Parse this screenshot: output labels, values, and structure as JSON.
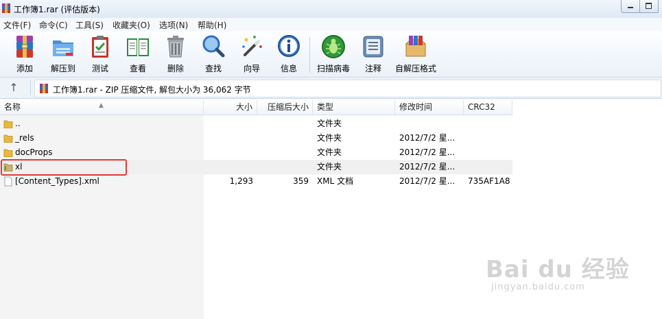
{
  "window": {
    "title": "工作簿1.rar (评估版本)"
  },
  "menu": [
    "文件(F)",
    "命令(C)",
    "工具(S)",
    "收藏夹(O)",
    "选项(N)",
    "帮助(H)"
  ],
  "toolbar": {
    "add": "添加",
    "extract": "解压到",
    "test": "测试",
    "view": "查看",
    "delete": "删除",
    "find": "查找",
    "wizard": "向导",
    "info": "信息",
    "virus_scan": "扫描病毒",
    "comment": "注释",
    "sfx": "自解压格式"
  },
  "address": {
    "text": "工作簿1.rar - ZIP 压缩文件, 解包大小为 36,062 字节"
  },
  "columns": {
    "name": "名称",
    "size": "大小",
    "packed": "压缩后大小",
    "type": "类型",
    "modified": "修改时间",
    "crc": "CRC32"
  },
  "files": [
    {
      "name": "..",
      "size": "",
      "packed": "",
      "type": "文件夹",
      "modified": "",
      "crc": ""
    },
    {
      "name": "_rels",
      "size": "",
      "packed": "",
      "type": "文件夹",
      "modified": "2012/7/2 星...",
      "crc": ""
    },
    {
      "name": "docProps",
      "size": "",
      "packed": "",
      "type": "文件夹",
      "modified": "2012/7/2 星...",
      "crc": ""
    },
    {
      "name": "xl",
      "size": "",
      "packed": "",
      "type": "文件夹",
      "modified": "2012/7/2 星...",
      "crc": ""
    },
    {
      "name": "[Content_Types].xml",
      "size": "1,293",
      "packed": "359",
      "type": "XML 文档",
      "modified": "2012/7/2 星...",
      "crc": "735AF1A8"
    }
  ],
  "watermark": {
    "main": "Bai du 经验",
    "sub": "jingyan.baidu.com"
  },
  "colors": {
    "folder": "#e8b93a",
    "highlight_box": "#e53935"
  }
}
